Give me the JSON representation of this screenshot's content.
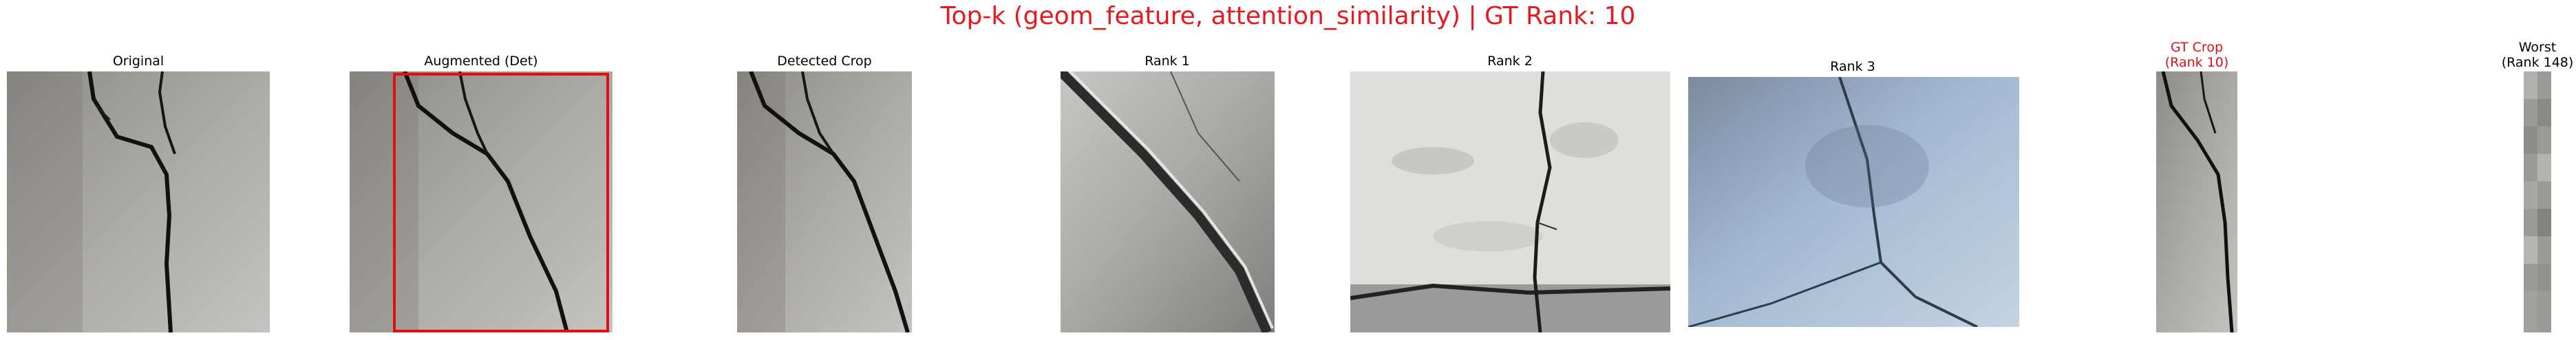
{
  "figure": {
    "title": "Top-k (geom_feature, attention_similarity) | GT Rank: 10",
    "title_color": "#e8191e",
    "highlight_color": "#e01010"
  },
  "panels": {
    "original": {
      "label": "Original"
    },
    "augmented": {
      "label": "Augmented (Det)"
    },
    "detected": {
      "label": "Detected Crop"
    },
    "rank1": {
      "label": "Rank 1"
    },
    "rank2": {
      "label": "Rank 2"
    },
    "rank3": {
      "label": "Rank 3"
    },
    "gt": {
      "label_line1": "GT Crop",
      "label_line2": "(Rank 10)"
    },
    "worst": {
      "label_line1": "Worst",
      "label_line2": "(Rank 148)"
    }
  }
}
